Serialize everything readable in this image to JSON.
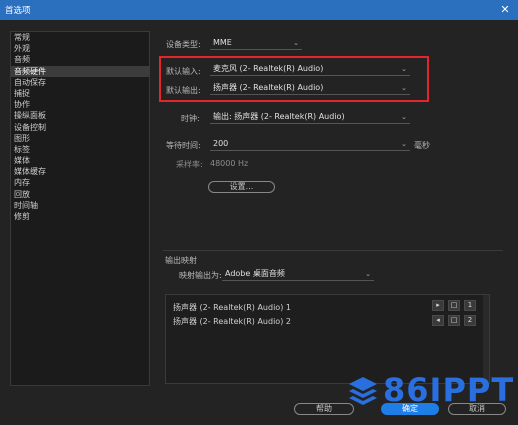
{
  "window": {
    "title": "首选项",
    "close_glyph": "✕"
  },
  "sidebar": {
    "selected_index": 3,
    "items": [
      {
        "label": "常规"
      },
      {
        "label": "外观"
      },
      {
        "label": "音频"
      },
      {
        "label": "音频硬件"
      },
      {
        "label": "自动保存"
      },
      {
        "label": "捕捉"
      },
      {
        "label": "协作"
      },
      {
        "label": "操纵面板"
      },
      {
        "label": "设备控制"
      },
      {
        "label": "图形"
      },
      {
        "label": "标签"
      },
      {
        "label": "媒体"
      },
      {
        "label": "媒体缓存"
      },
      {
        "label": "内存"
      },
      {
        "label": "回放"
      },
      {
        "label": "时间轴"
      },
      {
        "label": "修剪"
      }
    ]
  },
  "device_class": {
    "label": "设备类型:",
    "value": "MME"
  },
  "default_input": {
    "label": "默认输入:",
    "value": "麦克风 (2- Realtek(R) Audio)"
  },
  "default_output": {
    "label": "默认输出:",
    "value": "扬声器 (2- Realtek(R) Audio)"
  },
  "master_clock": {
    "label": "时钟:",
    "value": "输出: 扬声器 (2- Realtek(R) Audio)"
  },
  "latency": {
    "label": "等待时间:",
    "value": "200",
    "unit": "毫秒"
  },
  "sample_rate": {
    "label": "采样率:",
    "value": "48000 Hz"
  },
  "settings_button": {
    "label": "设置..."
  },
  "output_mapping": {
    "section_label": "输出映射",
    "map_label": "映射输出为:",
    "map_value": "Adobe 桌面音频",
    "rows": [
      {
        "label": "扬声器 (2- Realtek(R) Audio) 1",
        "channel": "1"
      },
      {
        "label": "扬声器 (2- Realtek(R) Audio) 2",
        "channel": "2"
      }
    ]
  },
  "footer": {
    "help_label": "帮助",
    "ok_label": "确定",
    "cancel_label": "取消"
  },
  "watermark": {
    "text": "86IPPT",
    "color": "#2a6fe0"
  },
  "colors": {
    "titlebar": "#2b6fbf",
    "highlight_box": "#e3262b",
    "primary_button": "#1e7ee6"
  }
}
